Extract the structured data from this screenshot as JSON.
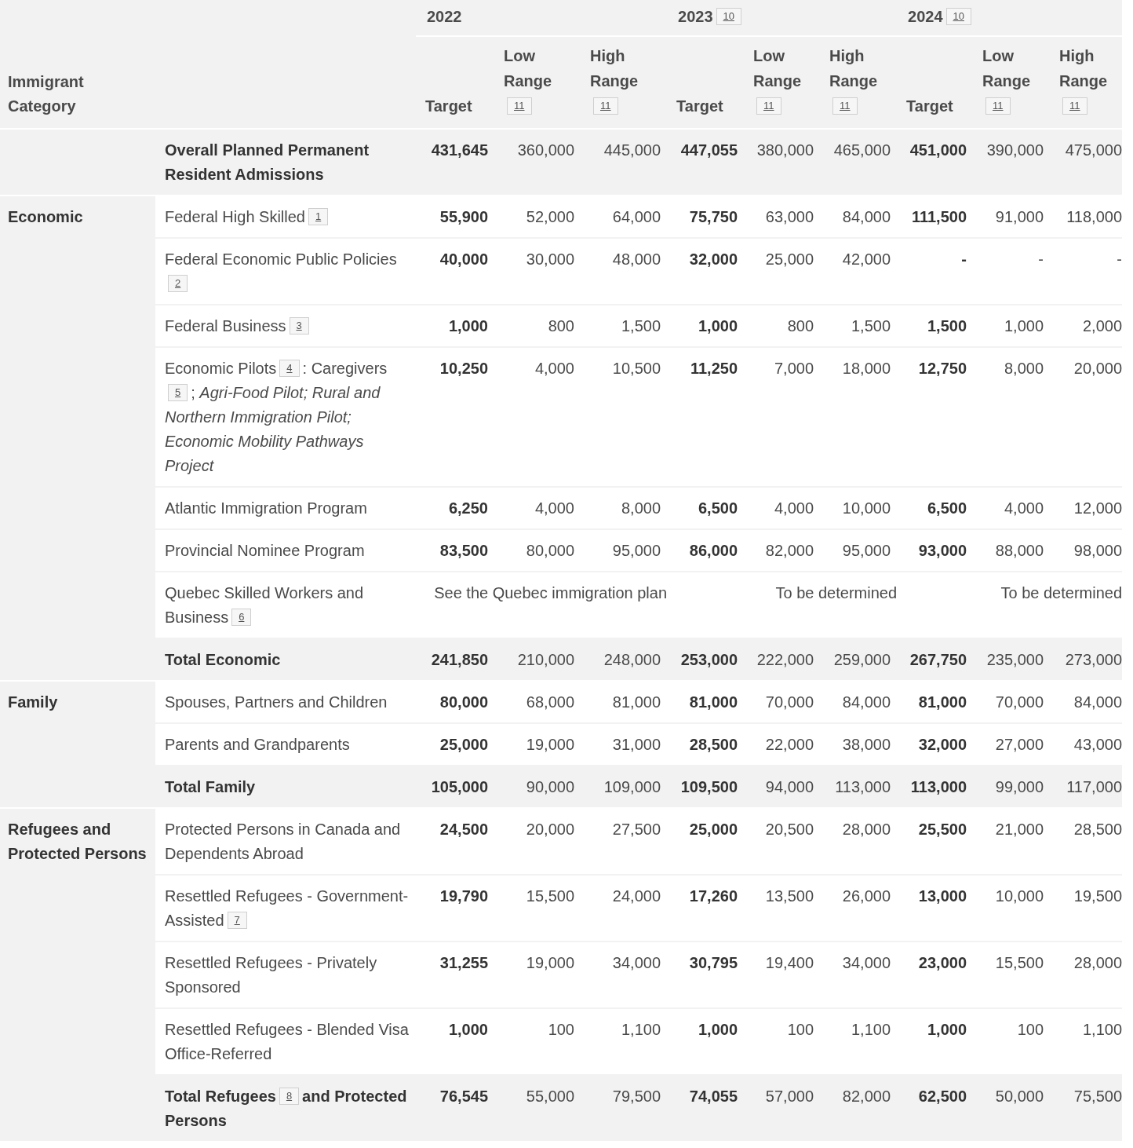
{
  "table": {
    "columns": {
      "category": "Immigrant Category",
      "years": [
        {
          "year": "2022",
          "sub": [
            {
              "label": "Target"
            },
            {
              "label": "Low Range",
              "footnote": "11"
            },
            {
              "label": "High Range",
              "footnote": "11"
            }
          ]
        },
        {
          "year": "2023",
          "footnote": "10",
          "sub": [
            {
              "label": "Target"
            },
            {
              "label": "Low Range",
              "footnote": "11"
            },
            {
              "label": "High Range",
              "footnote": "11"
            }
          ]
        },
        {
          "year": "2024",
          "footnote": "10",
          "sub": [
            {
              "label": "Target"
            },
            {
              "label": "Low Range",
              "footnote": "11"
            },
            {
              "label": "High Range",
              "footnote": "11"
            }
          ]
        }
      ]
    },
    "overall": {
      "kind": "total",
      "label": [
        {
          "kind": "text",
          "text": "Overall Planned Permanent Resident Admissions"
        }
      ],
      "values": [
        "431,645",
        "360,000",
        "445,000",
        "447,055",
        "380,000",
        "465,000",
        "451,000",
        "390,000",
        "475,000"
      ]
    },
    "groups": [
      {
        "category": "Economic",
        "rows": [
          {
            "kind": "item",
            "label": [
              {
                "kind": "text",
                "text": "Federal High Skilled"
              },
              {
                "kind": "footnote",
                "text": "1"
              }
            ],
            "values": [
              "55,900",
              "52,000",
              "64,000",
              "75,750",
              "63,000",
              "84,000",
              "111,500",
              "91,000",
              "118,000"
            ]
          },
          {
            "kind": "item",
            "label": [
              {
                "kind": "text",
                "text": "Federal Economic Public Policies"
              },
              {
                "kind": "footnote",
                "text": "2"
              }
            ],
            "values": [
              "40,000",
              "30,000",
              "48,000",
              "32,000",
              "25,000",
              "42,000",
              "-",
              "-",
              "-"
            ]
          },
          {
            "kind": "item",
            "label": [
              {
                "kind": "text",
                "text": "Federal Business"
              },
              {
                "kind": "footnote",
                "text": "3"
              }
            ],
            "values": [
              "1,000",
              "800",
              "1,500",
              "1,000",
              "800",
              "1,500",
              "1,500",
              "1,000",
              "2,000"
            ]
          },
          {
            "kind": "item",
            "label": [
              {
                "kind": "text",
                "text": "Economic Pilots"
              },
              {
                "kind": "footnote",
                "text": "4"
              },
              {
                "kind": "text",
                "text": ": Caregivers"
              },
              {
                "kind": "footnote",
                "text": "5"
              },
              {
                "kind": "text",
                "text": "; *Agri-Food Pilot; Rural and Northern Immigration Pilot; Economic Mobility Pathways Project*"
              }
            ],
            "values": [
              "10,250",
              "4,000",
              "10,500",
              "11,250",
              "7,000",
              "18,000",
              "12,750",
              "8,000",
              "20,000"
            ]
          },
          {
            "kind": "item",
            "label": [
              {
                "kind": "text",
                "text": "Atlantic Immigration Program"
              }
            ],
            "values": [
              "6,250",
              "4,000",
              "8,000",
              "6,500",
              "4,000",
              "10,000",
              "6,500",
              "4,000",
              "12,000"
            ]
          },
          {
            "kind": "item",
            "label": [
              {
                "kind": "text",
                "text": "Provincial Nominee Program"
              }
            ],
            "values": [
              "83,500",
              "80,000",
              "95,000",
              "86,000",
              "82,000",
              "95,000",
              "93,000",
              "88,000",
              "98,000"
            ]
          },
          {
            "kind": "merged",
            "label": [
              {
                "kind": "text",
                "text": "Quebec Skilled Workers and Business"
              },
              {
                "kind": "footnote",
                "text": "6"
              }
            ],
            "values": [
              "See the Quebec immigration plan",
              "To be determined",
              "To be determined"
            ]
          },
          {
            "kind": "total",
            "label": [
              {
                "kind": "text",
                "text": "Total Economic"
              }
            ],
            "values": [
              "241,850",
              "210,000",
              "248,000",
              "253,000",
              "222,000",
              "259,000",
              "267,750",
              "235,000",
              "273,000"
            ]
          }
        ]
      },
      {
        "category": "Family",
        "rows": [
          {
            "kind": "item",
            "label": [
              {
                "kind": "text",
                "text": "Spouses, Partners and Children"
              }
            ],
            "values": [
              "80,000",
              "68,000",
              "81,000",
              "81,000",
              "70,000",
              "84,000",
              "81,000",
              "70,000",
              "84,000"
            ]
          },
          {
            "kind": "item",
            "label": [
              {
                "kind": "text",
                "text": "Parents and Grandparents"
              }
            ],
            "values": [
              "25,000",
              "19,000",
              "31,000",
              "28,500",
              "22,000",
              "38,000",
              "32,000",
              "27,000",
              "43,000"
            ]
          },
          {
            "kind": "total",
            "label": [
              {
                "kind": "text",
                "text": "Total Family"
              }
            ],
            "values": [
              "105,000",
              "90,000",
              "109,000",
              "109,500",
              "94,000",
              "113,000",
              "113,000",
              "99,000",
              "117,000"
            ]
          }
        ]
      },
      {
        "category": "Refugees and Protected Persons",
        "rows": [
          {
            "kind": "item",
            "label": [
              {
                "kind": "text",
                "text": "Protected Persons in Canada and Dependents Abroad"
              }
            ],
            "values": [
              "24,500",
              "20,000",
              "27,500",
              "25,000",
              "20,500",
              "28,000",
              "25,500",
              "21,000",
              "28,500"
            ]
          },
          {
            "kind": "item",
            "label": [
              {
                "kind": "text",
                "text": "Resettled Refugees - Government-Assisted"
              },
              {
                "kind": "footnote",
                "text": "7"
              }
            ],
            "values": [
              "19,790",
              "15,500",
              "24,000",
              "17,260",
              "13,500",
              "26,000",
              "13,000",
              "10,000",
              "19,500"
            ]
          },
          {
            "kind": "item",
            "label": [
              {
                "kind": "text",
                "text": "Resettled Refugees - Privately Sponsored"
              }
            ],
            "values": [
              "31,255",
              "19,000",
              "34,000",
              "30,795",
              "19,400",
              "34,000",
              "23,000",
              "15,500",
              "28,000"
            ]
          },
          {
            "kind": "item",
            "label": [
              {
                "kind": "text",
                "text": "Resettled Refugees - Blended Visa Office-Referred"
              }
            ],
            "values": [
              "1,000",
              "100",
              "1,100",
              "1,000",
              "100",
              "1,100",
              "1,000",
              "100",
              "1,100"
            ]
          },
          {
            "kind": "total",
            "label": [
              {
                "kind": "text",
                "text": "Total Refugees"
              },
              {
                "kind": "footnote",
                "text": "8"
              },
              {
                "kind": "text",
                "text": "and Protected Persons"
              }
            ],
            "values": [
              "76,545",
              "55,000",
              "79,500",
              "74,055",
              "57,000",
              "82,000",
              "62,500",
              "50,000",
              "75,500"
            ]
          }
        ]
      }
    ]
  }
}
